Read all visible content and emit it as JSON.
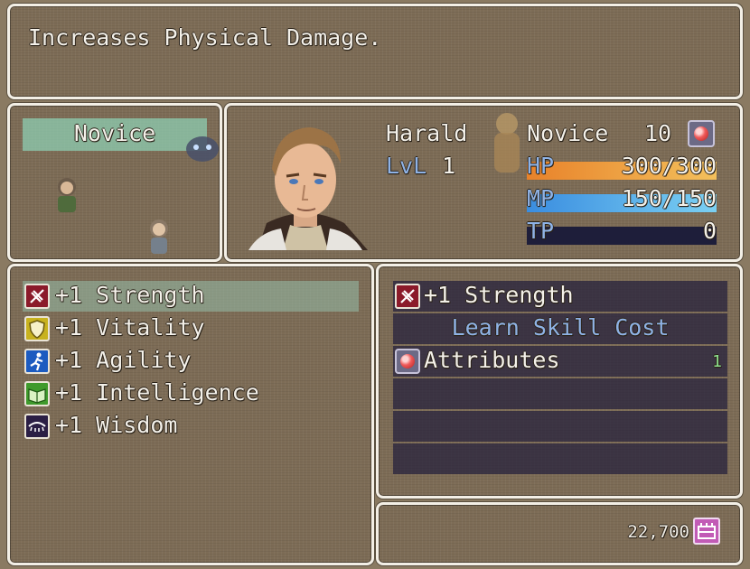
{
  "help": {
    "text": "Increases Physical Damage."
  },
  "class_window": {
    "selected_class": "Novice"
  },
  "actor": {
    "name": "Harald",
    "level_label": "LvL",
    "level": "1",
    "class": "Novice",
    "class_points": "10",
    "hp": {
      "label": "HP",
      "value": "300/300",
      "fill": 1.0
    },
    "mp": {
      "label": "MP",
      "value": "150/150",
      "fill": 1.0
    },
    "tp": {
      "label": "TP",
      "value": "0",
      "fill": 0.0
    }
  },
  "skills": {
    "selected_index": 0,
    "items": [
      {
        "label": "+1 Strength",
        "icon": "strength-icon",
        "color": "#8b1a2a"
      },
      {
        "label": "+1 Vitality",
        "icon": "vitality-shield-icon",
        "color": "#c8b21e"
      },
      {
        "label": "+1 Agility",
        "icon": "agility-runner-icon",
        "color": "#1c5bc0"
      },
      {
        "label": "+1 Intelligence",
        "icon": "intelligence-book-icon",
        "color": "#3f9a2c"
      },
      {
        "label": "+1 Wisdom",
        "icon": "wisdom-eye-icon",
        "color": "#2b1f45"
      }
    ]
  },
  "cost": {
    "skill_name": "+1 Strength",
    "header": "Learn Skill Cost",
    "attributes_label": "Attributes",
    "attributes_amount": "1"
  },
  "gold": {
    "value": "22,700",
    "icon": "gold-chest-icon"
  }
}
